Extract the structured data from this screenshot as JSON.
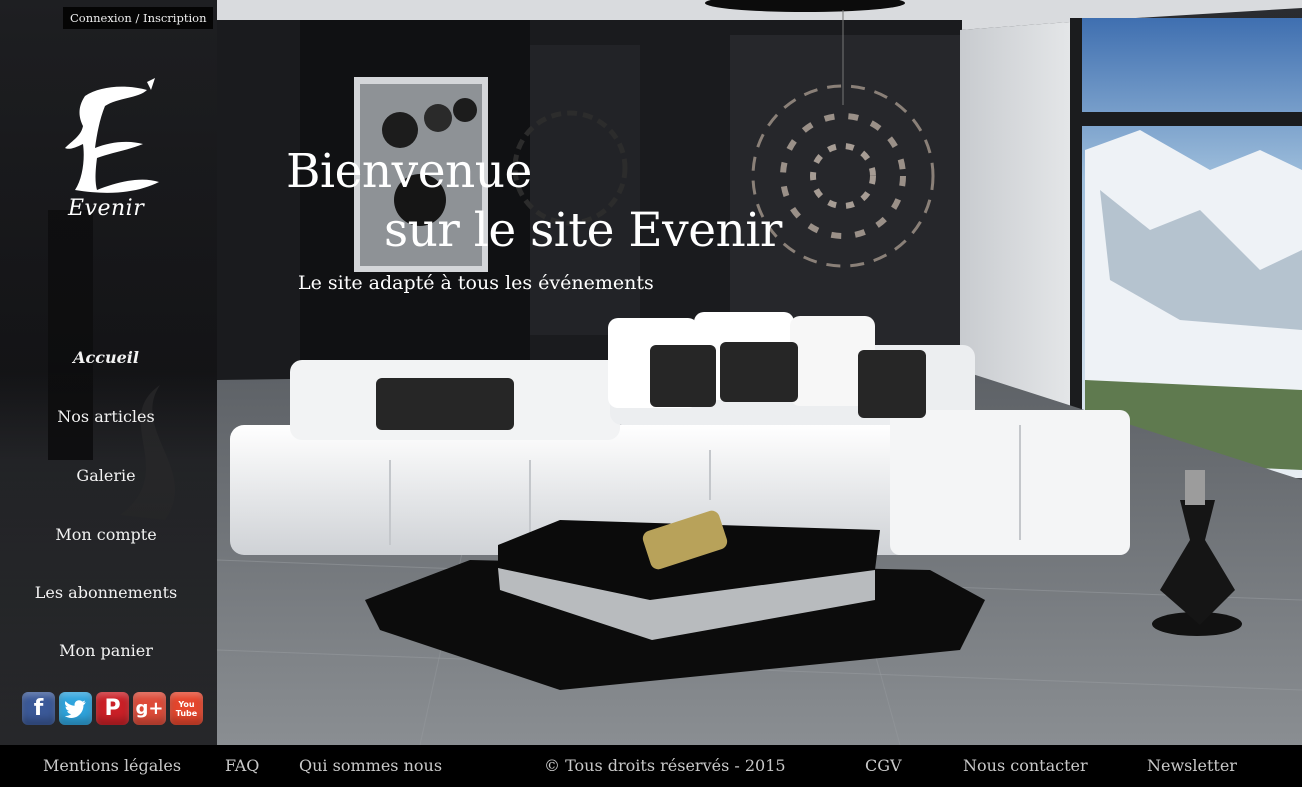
{
  "header": {
    "login_label": "Connexion / Inscription"
  },
  "logo": {
    "brand_name": "Evenir"
  },
  "nav": {
    "items": [
      {
        "label": "Accueil",
        "active": true
      },
      {
        "label": "Nos articles",
        "active": false
      },
      {
        "label": "Galerie",
        "active": false
      },
      {
        "label": "Mon compte",
        "active": false
      },
      {
        "label": "Les abonnements",
        "active": false
      },
      {
        "label": "Mon panier",
        "active": false
      }
    ]
  },
  "social": [
    {
      "name": "facebook-icon",
      "glyph": "f",
      "color": "#3b5998"
    },
    {
      "name": "twitter-icon",
      "glyph": "t",
      "color": "#2fa4dd"
    },
    {
      "name": "pinterest-icon",
      "glyph": "P",
      "color": "#cb2027"
    },
    {
      "name": "google-plus-icon",
      "glyph": "g+",
      "color": "#dd4b39"
    },
    {
      "name": "youtube-icon",
      "glyph": "You Tube",
      "color": "#e5462d"
    }
  ],
  "hero": {
    "headline_line1": "Bienvenue",
    "headline_line2": "sur le site Evenir",
    "tagline": "Le site adapté à tous les événements"
  },
  "footer": {
    "legal": "Mentions légales",
    "faq": "FAQ",
    "about": "Qui sommes nous",
    "copyright": "© Tous droits réservés - 2015",
    "cgv": "CGV",
    "contact": "Nous contacter",
    "newsletter": "Newsletter"
  },
  "colors": {
    "footer_bg": "#000000",
    "text": "#ffffff"
  }
}
